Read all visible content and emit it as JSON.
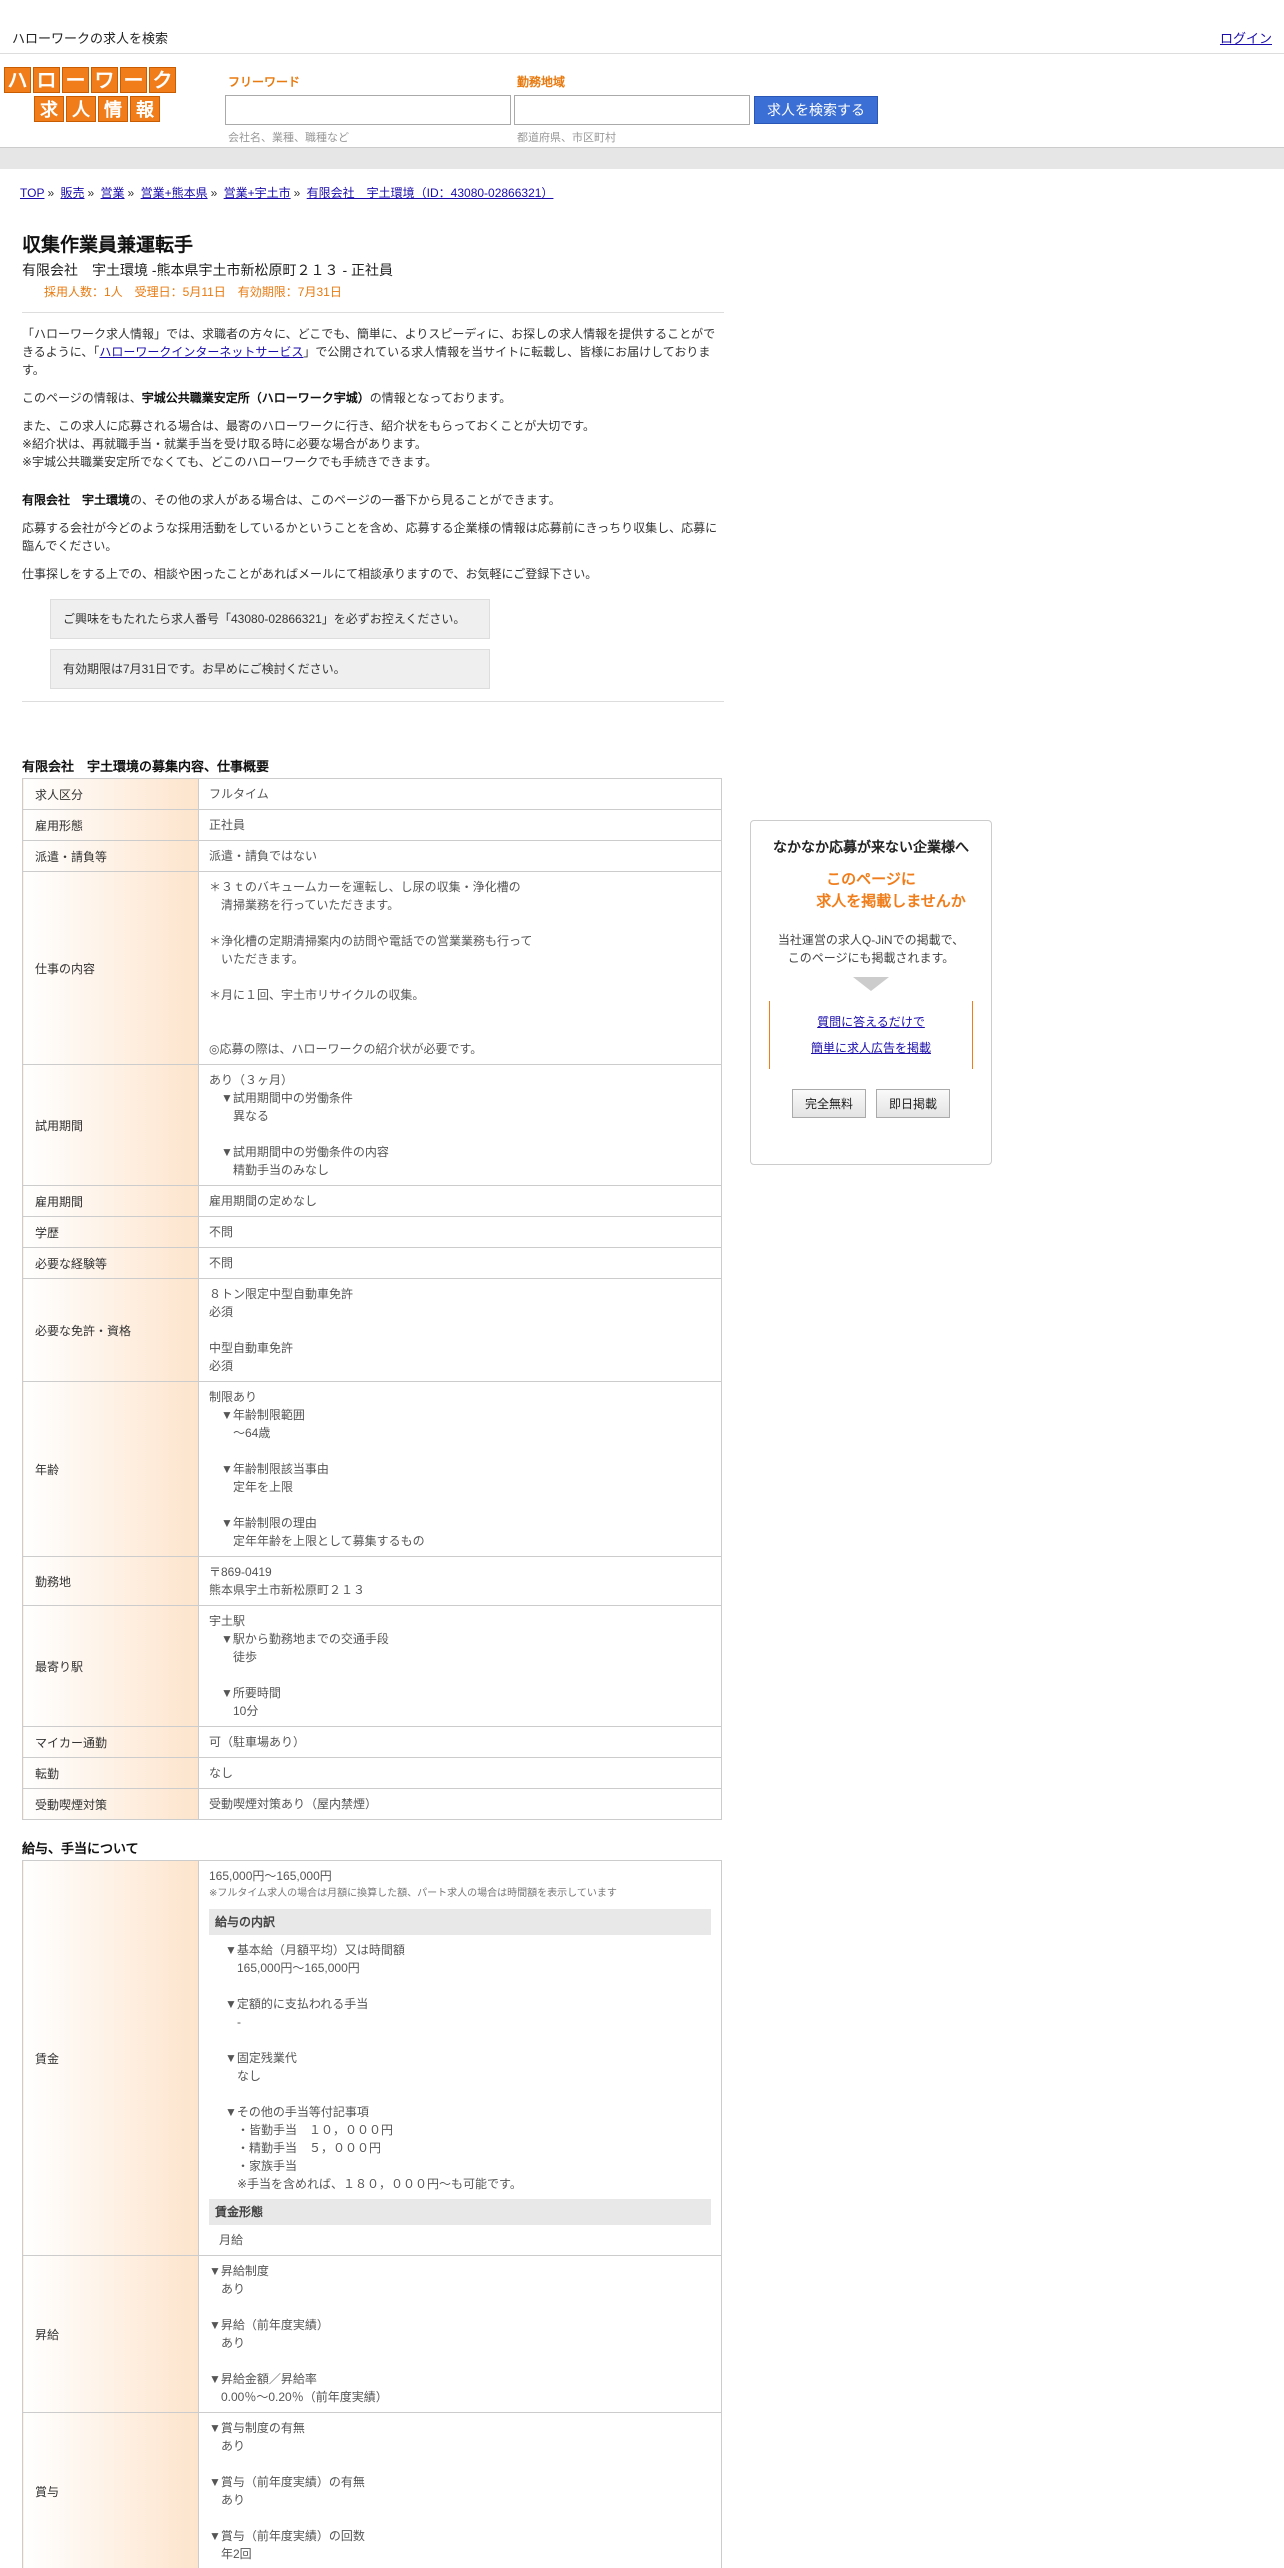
{
  "topbar": {
    "site_title": "ハローワークの求人を検索",
    "login": "ログイン"
  },
  "logo": {
    "top": [
      "ハ",
      "ロ",
      "ー",
      "ワ",
      "ー",
      "ク"
    ],
    "bottom": [
      "求",
      "人",
      "情",
      "報"
    ]
  },
  "search": {
    "keyword_label": "フリーワード",
    "keyword_hint": "会社名、業種、職種など",
    "area_label": "勤務地域",
    "area_hint": "都道府県、市区町村",
    "button": "求人を検索する"
  },
  "breadcrumb": [
    "TOP",
    "販売",
    "営業",
    "営業+熊本県",
    "営業+宇土市",
    "有限会社　宇土環境（ID：43080-02866321）"
  ],
  "job": {
    "title": "収集作業員兼運転手",
    "subtitle": "有限会社　宇土環境 -熊本県宇土市新松原町２１３ - 正社員",
    "meta": "採用人数：1人　受理日：5月11日　有効期限：7月31日"
  },
  "intro": {
    "p1_a": "「ハローワーク求人情報」では、求職者の方々に、どこでも、簡単に、よりスピーディに、お探しの求人情報を提供することができるように、「",
    "p1_link": "ハローワークインターネットサービス",
    "p1_b": "」で公開されている求人情報を当サイトに転載し、皆様にお届けしております。",
    "p2_a": "このページの情報は、",
    "p2_bold": "宇城公共職業安定所（ハローワーク宇城）",
    "p2_b": "の情報となっております。",
    "p3": "また、この求人に応募される場合は、最寄のハローワークに行き、紹介状をもらっておくことが大切です。\n※紹介状は、再就職手当・就業手当を受け取る時に必要な場合があります。\n※宇城公共職業安定所でなくても、どこのハローワークでも手続きできます。",
    "p4_bold": "有限会社　宇土環境",
    "p4": "の、その他の求人がある場合は、このページの一番下から見ることができます。",
    "p5": "応募する会社が今どのような採用活動をしているかということを含め、応募する企業様の情報は応募前にきっちり収集し、応募に臨んでください。",
    "p6": "仕事探しをする上での、相談や困ったことがあればメールにて相談承りますので、お気軽にご登録下さい。",
    "notice1": "ご興味をもたれたら求人番号「43080-02866321」を必ずお控えください。",
    "notice2": "有効期限は7月31日です。お早めにご検討ください。"
  },
  "overview": {
    "heading": "有限会社　宇土環境の募集内容、仕事概要",
    "rows": [
      {
        "label": "求人区分",
        "value": "フルタイム"
      },
      {
        "label": "雇用形態",
        "value": "正社員"
      },
      {
        "label": "派遣・請負等",
        "value": "派遣・請負ではない"
      },
      {
        "label": "仕事の内容",
        "value": "＊３ｔのバキュームカーを運転し、し尿の収集・浄化槽の\n　清掃業務を行っていただきます。\n\n＊浄化槽の定期清掃案内の訪問や電話での営業業務も行って\n　いただきます。\n\n＊月に１回、宇土市リサイクルの収集。\n\n\n◎応募の際は、ハローワークの紹介状が必要です。"
      },
      {
        "label": "試用期間",
        "value": "あり（３ヶ月）\n　▼試用期間中の労働条件\n　　異なる\n\n　▼試用期間中の労働条件の内容\n　　精勤手当のみなし"
      },
      {
        "label": "雇用期間",
        "value": "雇用期間の定めなし"
      },
      {
        "label": "学歴",
        "value": "不問"
      },
      {
        "label": "必要な経験等",
        "value": "不問"
      },
      {
        "label": "必要な免許・資格",
        "value": "８トン限定中型自動車免許\n必須\n\n中型自動車免許\n必須\n"
      },
      {
        "label": "年齢",
        "value": "制限あり\n　▼年齢制限範囲\n　　〜64歳\n\n　▼年齢制限該当事由\n　　定年を上限\n\n　▼年齢制限の理由\n　　定年年齢を上限として募集するもの"
      },
      {
        "label": "勤務地",
        "value": "〒869-0419\n熊本県宇土市新松原町２１３"
      },
      {
        "label": "最寄り駅",
        "value": "宇土駅\n　▼駅から勤務地までの交通手段\n　　徒歩\n\n　▼所要時間\n　　10分"
      },
      {
        "label": "マイカー通勤",
        "value": "可（駐車場あり）"
      },
      {
        "label": "転勤",
        "value": "なし"
      },
      {
        "label": "受動喫煙対策",
        "value": "受動喫煙対策あり（屋内禁煙）"
      }
    ]
  },
  "salary": {
    "heading": "給与、手当について",
    "wage_label": "賃金",
    "wage_range": "165,000円〜165,000円",
    "wage_note": "※フルタイム求人の場合は月額に換算した額、パート求人の場合は時間額を表示しています",
    "breakdown_heading": "給与の内訳",
    "breakdown": "▼基本給（月額平均）又は時間額\n　165,000円〜165,000円\n\n▼定額的に支払われる手当\n　-\n\n▼固定残業代\n　なし\n\n▼その他の手当等付記事項\n　・皆勤手当　１０，０００円\n　・精勤手当　５，０００円\n　・家族手当\n　※手当を含めれば、１８０，０００円～も可能です。",
    "form_heading": "賃金形態",
    "form_value": "月給",
    "raise_label": "昇給",
    "raise_value": "▼昇給制度\n　あり\n\n▼昇給（前年度実績）\n　あり\n\n▼昇給金額／昇給率\n　0.00％〜0.20％（前年度実績）",
    "bonus_label": "賞与",
    "bonus_value": "▼賞与制度の有無\n　あり\n\n▼賞与（前年度実績）の有無\n　あり\n\n▼賞与（前年度実績）の回数\n　年2回"
  },
  "ad": {
    "title": "なかなか応募が来ない企業様へ",
    "orange_1": "このページに",
    "orange_2": "求人を掲載しませんか",
    "text": "当社運営の求人Q-JiNでの掲載で、\nこのページにも掲載されます。",
    "link1": "質問に答えるだけで",
    "link2": "簡単に求人広告を掲載",
    "btn1": "完全無料",
    "btn2": "即日掲載"
  }
}
